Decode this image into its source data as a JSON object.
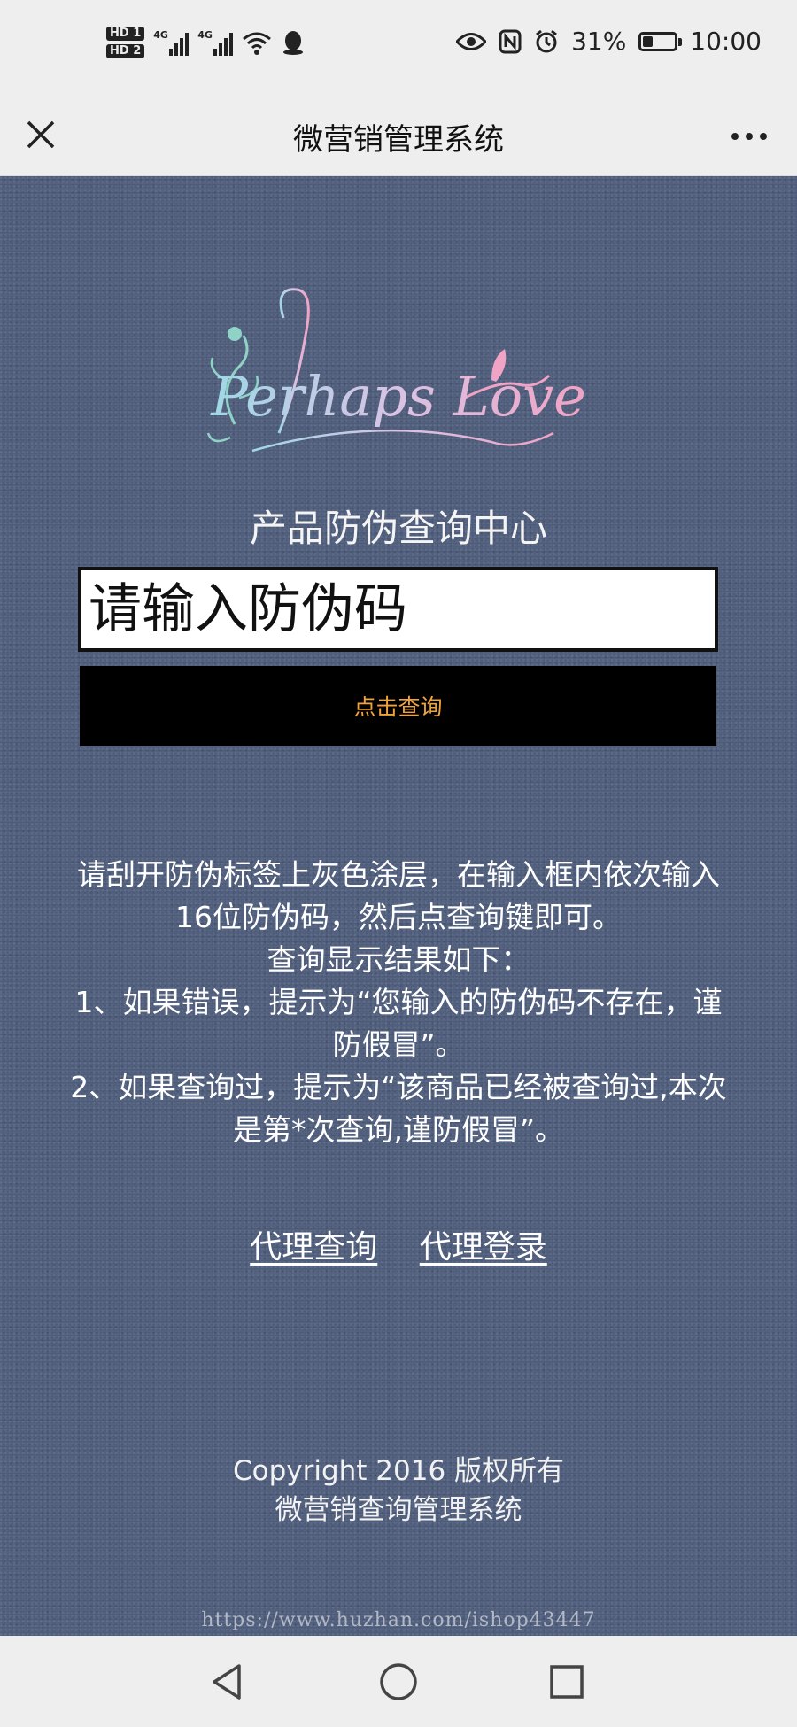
{
  "status_bar": {
    "hd1": "HD 1",
    "hd2": "HD 2",
    "net1": "4G",
    "net2": "4G",
    "battery_text": "31%",
    "battery_level": 0.31,
    "time": "10:00",
    "icons": [
      "wifi-icon",
      "qq-icon",
      "eye-icon",
      "nfc-icon",
      "alarm-icon",
      "battery-icon"
    ]
  },
  "title_bar": {
    "title": "微营销管理系统"
  },
  "logo": {
    "text": "Perhaps Love"
  },
  "main": {
    "title": "产品防伪查询中心",
    "input_placeholder": "请输入防伪码",
    "button_label": "点击查询",
    "instructions": [
      "请刮开防伪标签上灰色涂层，在输入框内依次输入16位防伪码，然后点查询键即可。",
      "查询显示结果如下：",
      "1、如果错误，提示为“您输入的防伪码不存在，谨防假冒”。",
      "2、如果查询过，提示为“该商品已经被查询过,本次是第*次查询,谨防假冒”。"
    ],
    "links": {
      "agent_query": "代理查询",
      "agent_login": "代理登录"
    }
  },
  "footer": {
    "copyright": "Copyright 2016 版权所有",
    "system_name": "微营销查询管理系统",
    "watermark": "https://www.huzhan.com/ishop43447"
  },
  "colors": {
    "background": "#4c5b7a",
    "button_bg": "#000000",
    "button_text": "#f0a33a",
    "bars": "#eeeeee"
  }
}
